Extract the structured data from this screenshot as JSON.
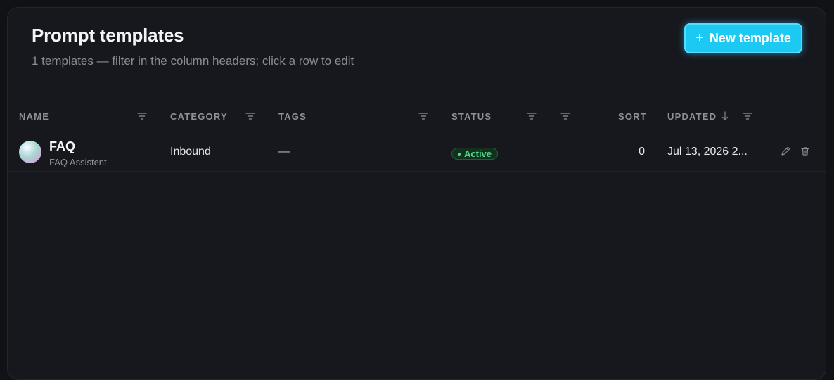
{
  "header": {
    "title": "Prompt templates",
    "subtitle": "1 templates — filter in the column headers; click a row to edit",
    "new_button_label": "New template"
  },
  "table": {
    "columns": {
      "name": "NAME",
      "category": "CATEGORY",
      "tags": "TAGS",
      "status": "STATUS",
      "sort": "SORT",
      "updated": "UPDATED"
    },
    "sorted_column": "updated",
    "sort_direction": "descending",
    "rows": [
      {
        "name": "FAQ",
        "description": "FAQ Assistent",
        "category": "Inbound",
        "tags": "—",
        "status": "Active",
        "sort": "0",
        "updated": "Jul 13, 2026 2..."
      }
    ]
  },
  "colors": {
    "accent": "#1cc9f2",
    "status_active": "#4ddc8c",
    "panel_bg": "#17181d",
    "page_bg": "#111216"
  }
}
